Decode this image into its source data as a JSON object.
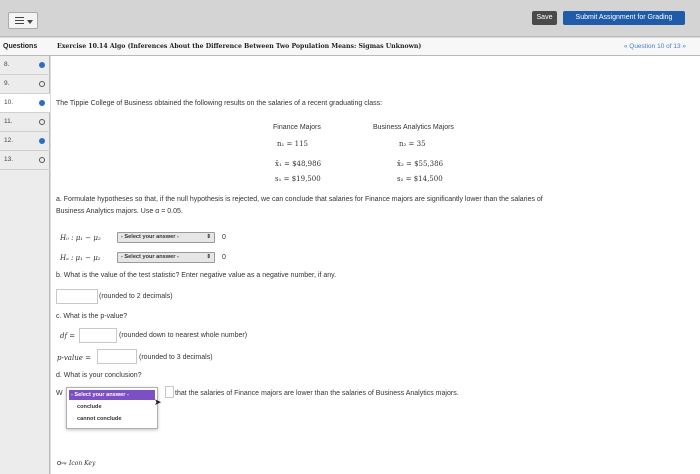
{
  "toolbar": {
    "save_label": "Save",
    "submit_label": "Submit Assignment for Grading"
  },
  "header": {
    "questions_label": "Questions",
    "exercise_title": "Exercise 10.14 Algo (Inferences About the Difference Between Two Population Means: Sigmas Unknown)",
    "question_nav": "« Question 10 of 13 »"
  },
  "sidebar": {
    "items": [
      {
        "num": "8.",
        "status": "answered"
      },
      {
        "num": "9.",
        "status": "unanswered"
      },
      {
        "num": "10.",
        "status": "answered"
      },
      {
        "num": "11.",
        "status": "unanswered"
      },
      {
        "num": "12.",
        "status": "answered"
      },
      {
        "num": "13.",
        "status": "unanswered"
      }
    ]
  },
  "problem": {
    "intro": "The Tippie College of Business obtained the following results on the salaries of a recent graduating class:",
    "table": {
      "col1_header": "Finance Majors",
      "col2_header": "Business Analytics Majors",
      "n1": "n₁ = 115",
      "n2": "n₂ = 35",
      "x1": "x̄₁ = $48,986",
      "x2": "x̄₂ = $55,386",
      "s1": "s₁ = $19,500",
      "s2": "s₂ = $14,500"
    },
    "part_a_line1": "a. Formulate hypotheses so that, if the null hypothesis is rejected, we can conclude that salaries for Finance majors are significantly lower than the salaries of",
    "part_a_line2": "Business Analytics majors. Use α = 0.05.",
    "h0_label": "H₀ : μ₁ − μ₂",
    "ha_label": "Hₐ : μ₁ − μ₂",
    "select_placeholder": "- Select your answer -",
    "zero": "0",
    "part_b": "b. What is the value of the test statistic? Enter negative value as a negative number, if any.",
    "hint_b": "(rounded to 2 decimals)",
    "part_c": "c. What is the p-value?",
    "df_label": "df =",
    "hint_df": "(rounded down to nearest whole number)",
    "pvalue_label": "p-value =",
    "hint_p": "(rounded to 3 decimals)",
    "part_d": "d. What is your conclusion?",
    "conclusion_prefix": "W",
    "conclusion_text": "that the salaries of Finance majors are lower than the salaries of Business Analytics majors.",
    "dropdown_highlight": "- Select your answer -",
    "dropdown_options": [
      "conclude",
      "cannot conclude"
    ],
    "icon_key_label": "Icon Key"
  },
  "colors": {
    "accent": "#1f5ba8",
    "dot": "#2d6cc4",
    "highlight": "#7c4fc4"
  }
}
